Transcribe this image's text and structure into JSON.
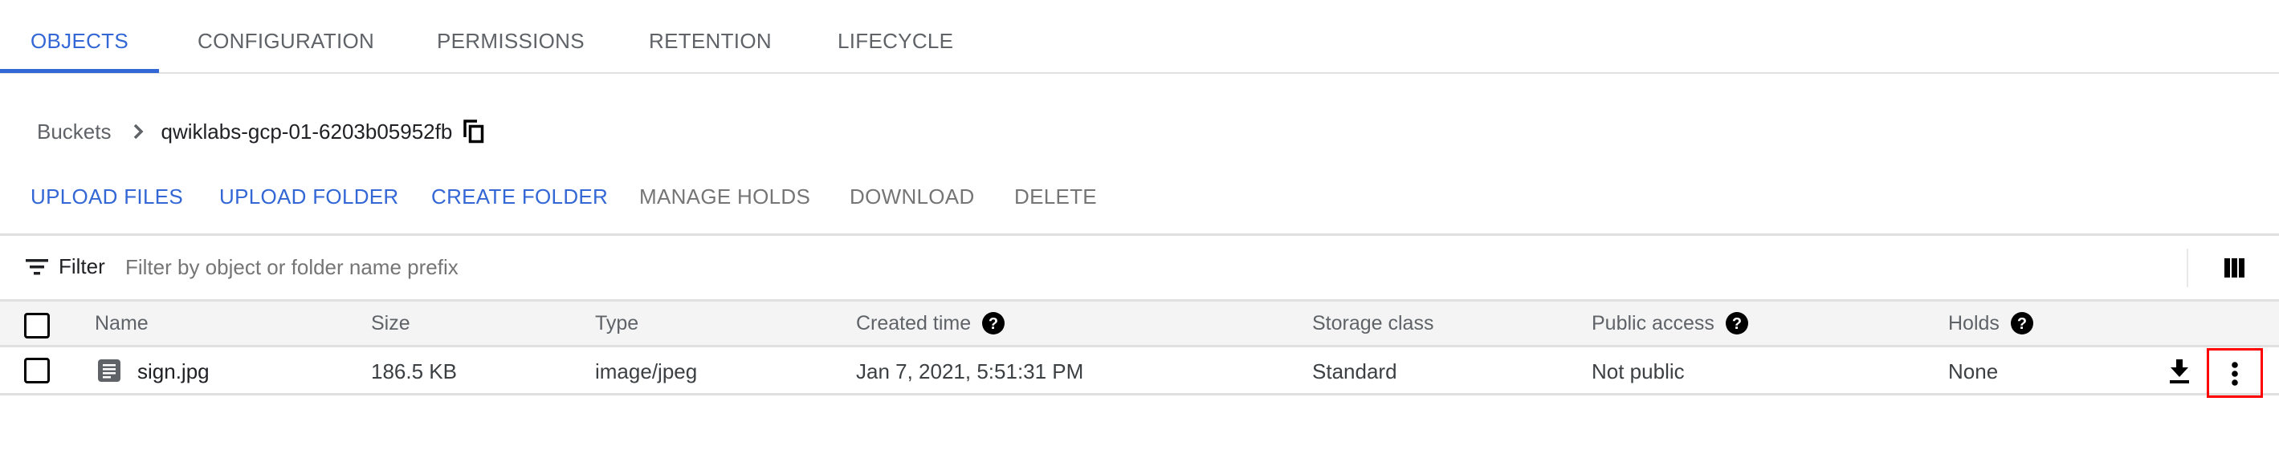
{
  "tabs": [
    {
      "label": "OBJECTS",
      "active": true
    },
    {
      "label": "CONFIGURATION",
      "active": false
    },
    {
      "label": "PERMISSIONS",
      "active": false
    },
    {
      "label": "RETENTION",
      "active": false
    },
    {
      "label": "LIFECYCLE",
      "active": false
    }
  ],
  "breadcrumb": {
    "root": "Buckets",
    "separator_icon": "chevron-right-icon",
    "current": "qwiklabs-gcp-01-6203b05952fb",
    "copy_icon": "copy-icon"
  },
  "actions": [
    {
      "label": "UPLOAD FILES",
      "enabled": true
    },
    {
      "label": "UPLOAD FOLDER",
      "enabled": true
    },
    {
      "label": "CREATE FOLDER",
      "enabled": true
    },
    {
      "label": "MANAGE HOLDS",
      "enabled": false
    },
    {
      "label": "DOWNLOAD",
      "enabled": false
    },
    {
      "label": "DELETE",
      "enabled": false
    }
  ],
  "filter": {
    "icon": "filter-icon",
    "label": "Filter",
    "placeholder": "Filter by object or folder name prefix",
    "value": "",
    "column_display_icon": "view-column-icon"
  },
  "table": {
    "columns": [
      {
        "label": "Name",
        "help": false
      },
      {
        "label": "Size",
        "help": false
      },
      {
        "label": "Type",
        "help": false
      },
      {
        "label": "Created time",
        "help": true
      },
      {
        "label": "Storage class",
        "help": false
      },
      {
        "label": "Public access",
        "help": true
      },
      {
        "label": "Holds",
        "help": true
      }
    ],
    "rows": [
      {
        "name": "sign.jpg",
        "icon": "file-icon",
        "size": "186.5 KB",
        "type": "image/jpeg",
        "created": "Jan 7, 2021, 5:51:31 PM",
        "storage_class": "Standard",
        "public_access": "Not public",
        "holds": "None",
        "checked": false
      }
    ]
  },
  "colors": {
    "accent": "#3367d6",
    "highlight_box": "#ff0000",
    "disabled_text": "#757575"
  }
}
